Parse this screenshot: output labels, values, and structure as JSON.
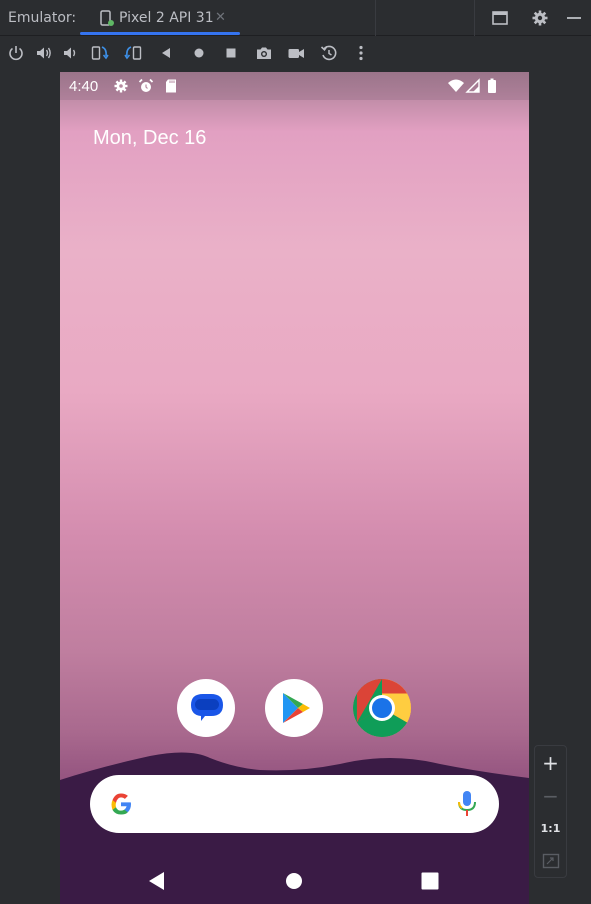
{
  "title_bar": {
    "label": "Emulator:",
    "tab": {
      "label": "Pixel 2 API 31",
      "close": "✕",
      "icon": "phone-device-icon"
    },
    "buttons": [
      "restore-window-icon",
      "settings-gear-icon",
      "minimize-icon"
    ]
  },
  "toolbar": {
    "tools": [
      {
        "name": "power-icon"
      },
      {
        "name": "volume-up-icon"
      },
      {
        "name": "volume-down-icon"
      },
      {
        "name": "rotate-left-icon"
      },
      {
        "name": "rotate-right-icon"
      },
      {
        "name": "back-icon"
      },
      {
        "name": "home-icon"
      },
      {
        "name": "overview-icon"
      },
      {
        "name": "camera-icon"
      },
      {
        "name": "video-record-icon"
      },
      {
        "name": "snapshot-restore-icon"
      },
      {
        "name": "more-options-icon"
      }
    ]
  },
  "device": {
    "status_bar": {
      "time": "4:40",
      "left_icons": [
        "settings-icon",
        "alarm-icon",
        "sd-card-icon"
      ],
      "right_icons": [
        "wifi-icon",
        "cell-signal-icon",
        "battery-icon"
      ]
    },
    "date": "Mon, Dec 16",
    "dock_apps": [
      {
        "name": "messages-app-icon"
      },
      {
        "name": "play-store-app-icon"
      },
      {
        "name": "chrome-app-icon"
      }
    ],
    "search": {
      "logo": "google-logo-icon",
      "mic": "microphone-icon"
    },
    "nav": [
      "back-nav-icon",
      "home-nav-icon",
      "recents-nav-icon"
    ]
  },
  "zoom": {
    "plus": "+",
    "minus": "−",
    "one_to_one": "1:1",
    "fit": "fit-screen-icon"
  },
  "colors": {
    "accent": "#3574f0",
    "ide_bg": "#2b2d30",
    "text": "#bcbec4"
  }
}
